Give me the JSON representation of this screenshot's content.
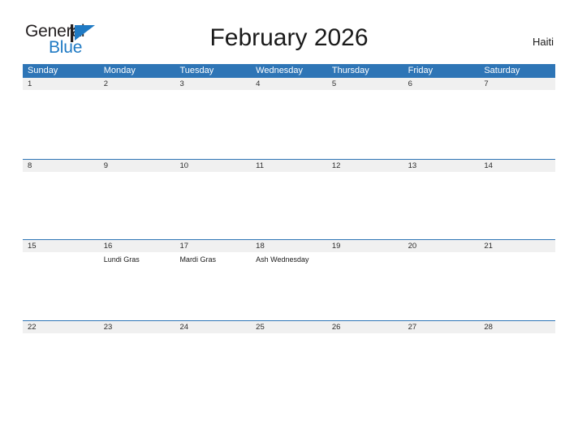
{
  "header": {
    "logo": {
      "word_one": "General",
      "word_two": "Blue",
      "mark_icon": "triangle-flag-icon",
      "color_dark": "#231f20",
      "color_blue": "#1f7ac4"
    },
    "title": "February 2026",
    "region": "Haiti"
  },
  "theme": {
    "header_blue": "#2E75B6",
    "row_divider_blue": "#2E75B6",
    "day_strip_gray": "#F0F0F0",
    "text_dark": "#1a1a1a"
  },
  "calendar": {
    "month": "February",
    "year": "2026",
    "weekday_headers": [
      "Sunday",
      "Monday",
      "Tuesday",
      "Wednesday",
      "Thursday",
      "Friday",
      "Saturday"
    ],
    "weeks": [
      {
        "days": [
          {
            "num": "1",
            "event": ""
          },
          {
            "num": "2",
            "event": ""
          },
          {
            "num": "3",
            "event": ""
          },
          {
            "num": "4",
            "event": ""
          },
          {
            "num": "5",
            "event": ""
          },
          {
            "num": "6",
            "event": ""
          },
          {
            "num": "7",
            "event": ""
          }
        ]
      },
      {
        "days": [
          {
            "num": "8",
            "event": ""
          },
          {
            "num": "9",
            "event": ""
          },
          {
            "num": "10",
            "event": ""
          },
          {
            "num": "11",
            "event": ""
          },
          {
            "num": "12",
            "event": ""
          },
          {
            "num": "13",
            "event": ""
          },
          {
            "num": "14",
            "event": ""
          }
        ]
      },
      {
        "days": [
          {
            "num": "15",
            "event": ""
          },
          {
            "num": "16",
            "event": "Lundi Gras"
          },
          {
            "num": "17",
            "event": "Mardi Gras"
          },
          {
            "num": "18",
            "event": "Ash Wednesday"
          },
          {
            "num": "19",
            "event": ""
          },
          {
            "num": "20",
            "event": ""
          },
          {
            "num": "21",
            "event": ""
          }
        ]
      },
      {
        "days": [
          {
            "num": "22",
            "event": ""
          },
          {
            "num": "23",
            "event": ""
          },
          {
            "num": "24",
            "event": ""
          },
          {
            "num": "25",
            "event": ""
          },
          {
            "num": "26",
            "event": ""
          },
          {
            "num": "27",
            "event": ""
          },
          {
            "num": "28",
            "event": ""
          }
        ]
      }
    ]
  }
}
